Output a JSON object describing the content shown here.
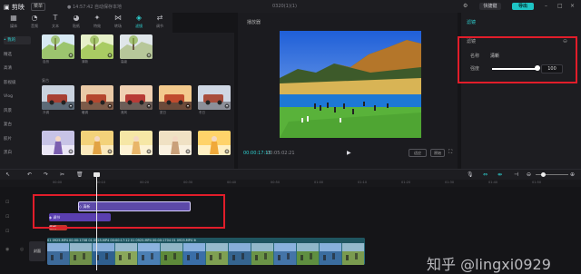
{
  "titlebar": {
    "logo": "▣ 剪映",
    "menu": "菜单",
    "autosave": "● 14:57:42 自动保存本地",
    "project_title": "0320(1)(1)",
    "shortcut": "快捷键",
    "export": "导出"
  },
  "tools": [
    {
      "icon": "media-icon",
      "glyph": "▦",
      "label": "媒体"
    },
    {
      "icon": "audio-icon",
      "glyph": "◔",
      "label": "音频"
    },
    {
      "icon": "text-icon",
      "glyph": "T",
      "label": "文本"
    },
    {
      "icon": "sticker-icon",
      "glyph": "◕",
      "label": "贴纸"
    },
    {
      "icon": "effects-icon",
      "glyph": "✦",
      "label": "特效"
    },
    {
      "icon": "transition-icon",
      "glyph": "⋈",
      "label": "转场"
    },
    {
      "icon": "filter-icon",
      "glyph": "◈",
      "label": "滤镜"
    },
    {
      "icon": "adjust-icon",
      "glyph": "⇄",
      "label": "调节"
    }
  ],
  "leftnav": [
    "• 我的",
    "精选",
    "高清",
    "影视级",
    "Vlog",
    "风景",
    "复古",
    "胶片",
    "黑白"
  ],
  "leftnav_active_index": 0,
  "filters": {
    "row1_labels": [
      "自然",
      "清新",
      "高级"
    ],
    "section_label": "复古",
    "row2_labels": [
      "冷调",
      "暖调",
      "港风",
      "夏日",
      "冬日"
    ],
    "row3_labels": [
      "",
      "",
      "",
      "",
      ""
    ]
  },
  "player": {
    "title": "播放器",
    "current_time": "00:00:17:15",
    "total_time": "00:05:02:21",
    "btn_ratio": "适应",
    "btn_original": "原始"
  },
  "properties": {
    "tab": "滤镜",
    "subtitle": "滤镜",
    "name_label": "名称",
    "name_value": "清新",
    "intensity_label": "强度",
    "intensity_value": "100",
    "intensity_fraction": 1.0
  },
  "timeline": {
    "ruler_ticks": [
      "00:00",
      "00:10",
      "00:20",
      "00:30",
      "00:40",
      "00:50",
      "01:00",
      "01:10",
      "01:20",
      "01:30",
      "01:40",
      "01:50"
    ],
    "filter_clip": "◇ 清新",
    "effect_clip": "◈ 调节",
    "audio_clip": "音频",
    "cover_label": "封面",
    "video_clip_label": "01 0925.MP4  00:00:1708  01 0925.MP4  00:00:17:12  01 0925.MP4  00:00:1704  01 0925.MP4 ※"
  },
  "watermark": "知乎 @lingxi0929",
  "colors": {
    "accent": "#2ed0d0",
    "highlight": "#e11d2a",
    "filter_clip": "#5c49a8",
    "effect_clip": "#5a3fb0"
  }
}
